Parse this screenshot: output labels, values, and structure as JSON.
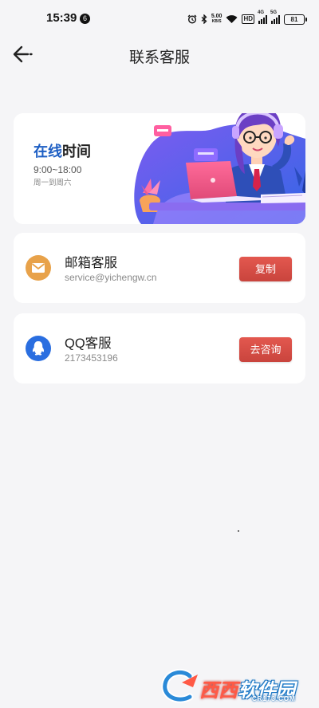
{
  "status_bar": {
    "time": "15:39",
    "notification_count": "6",
    "net_speed_value": "5.00",
    "net_speed_unit": "KB/S",
    "hd_label": "HD",
    "signal1_gen": "4G",
    "signal2_gen": "5G",
    "battery": "81"
  },
  "header": {
    "title": "联系客服"
  },
  "banner": {
    "title_highlight": "在线",
    "title_rest": "时间",
    "hours": "9:00~18:00",
    "days": "周一到周六"
  },
  "contacts": [
    {
      "title": "邮箱客服",
      "value": "service@yichengw.cn",
      "button": "复制",
      "icon": "mail-icon"
    },
    {
      "title": "QQ客服",
      "value": "2173453196",
      "button": "去咨询",
      "icon": "qq-icon"
    }
  ],
  "watermark": {
    "logo_text_a": "西西",
    "logo_text_b": "软件园",
    "sub": "CR173.COM"
  },
  "colors": {
    "accent_blue": "#1e5fc4",
    "button_red": "#d54b43",
    "mail_orange": "#e8a24a",
    "qq_blue": "#2a6ee0",
    "background": "#f5f5f7"
  }
}
